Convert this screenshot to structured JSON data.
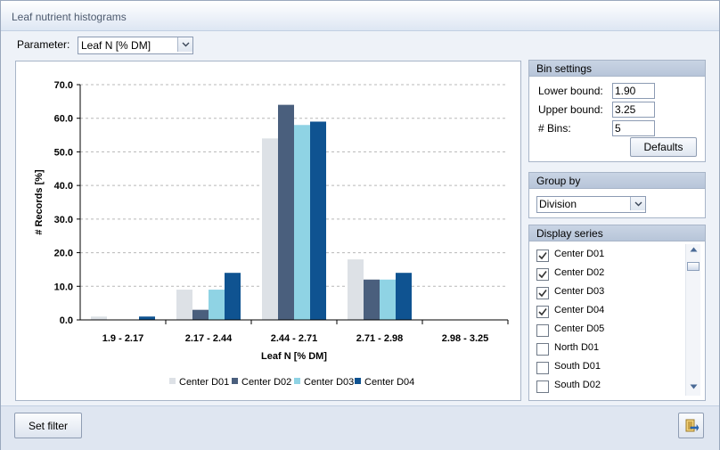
{
  "window": {
    "title": "Leaf nutrient histograms"
  },
  "parameter": {
    "label": "Parameter:",
    "selected": "Leaf N [% DM]",
    "dropdown_icon": "chevron-down-icon"
  },
  "bin_settings": {
    "title": "Bin settings",
    "lower_label": "Lower bound:",
    "lower_value": "1.90",
    "upper_label": "Upper bound:",
    "upper_value": "3.25",
    "bins_label": "# Bins:",
    "bins_value": "5",
    "defaults_label": "Defaults"
  },
  "group_by": {
    "title": "Group by",
    "selected": "Division"
  },
  "display_series": {
    "title": "Display series",
    "items": [
      {
        "label": "Center D01",
        "checked": true
      },
      {
        "label": "Center D02",
        "checked": true
      },
      {
        "label": "Center D03",
        "checked": true
      },
      {
        "label": "Center D04",
        "checked": true
      },
      {
        "label": "Center D05",
        "checked": false
      },
      {
        "label": "North D01",
        "checked": false
      },
      {
        "label": "South D01",
        "checked": false
      },
      {
        "label": "South D02",
        "checked": false
      }
    ]
  },
  "bottom": {
    "set_filter_label": "Set filter",
    "export_icon": "export-icon"
  },
  "colors": {
    "series": [
      "#dde1e6",
      "#4a5f7d",
      "#8fd3e4",
      "#0f5391"
    ]
  },
  "chart_data": {
    "type": "bar",
    "categories": [
      "1.9 - 2.17",
      "2.17 - 2.44",
      "2.44 - 2.71",
      "2.71 - 2.98",
      "2.98 - 3.25"
    ],
    "series": [
      {
        "name": "Center D01",
        "values": [
          1,
          9,
          54,
          18,
          0
        ]
      },
      {
        "name": "Center D02",
        "values": [
          0,
          3,
          64,
          12,
          0
        ]
      },
      {
        "name": "Center D03",
        "values": [
          0,
          9,
          58,
          12,
          0
        ]
      },
      {
        "name": "Center D04",
        "values": [
          1,
          14,
          59,
          14,
          0
        ]
      }
    ],
    "xlabel": "Leaf N [% DM]",
    "ylabel": "# Records [%]",
    "ylim": [
      0,
      70
    ],
    "yticks": [
      "0.0",
      "10.0",
      "20.0",
      "30.0",
      "40.0",
      "50.0",
      "60.0",
      "70.0"
    ],
    "grid": true,
    "legend": "bottom"
  }
}
